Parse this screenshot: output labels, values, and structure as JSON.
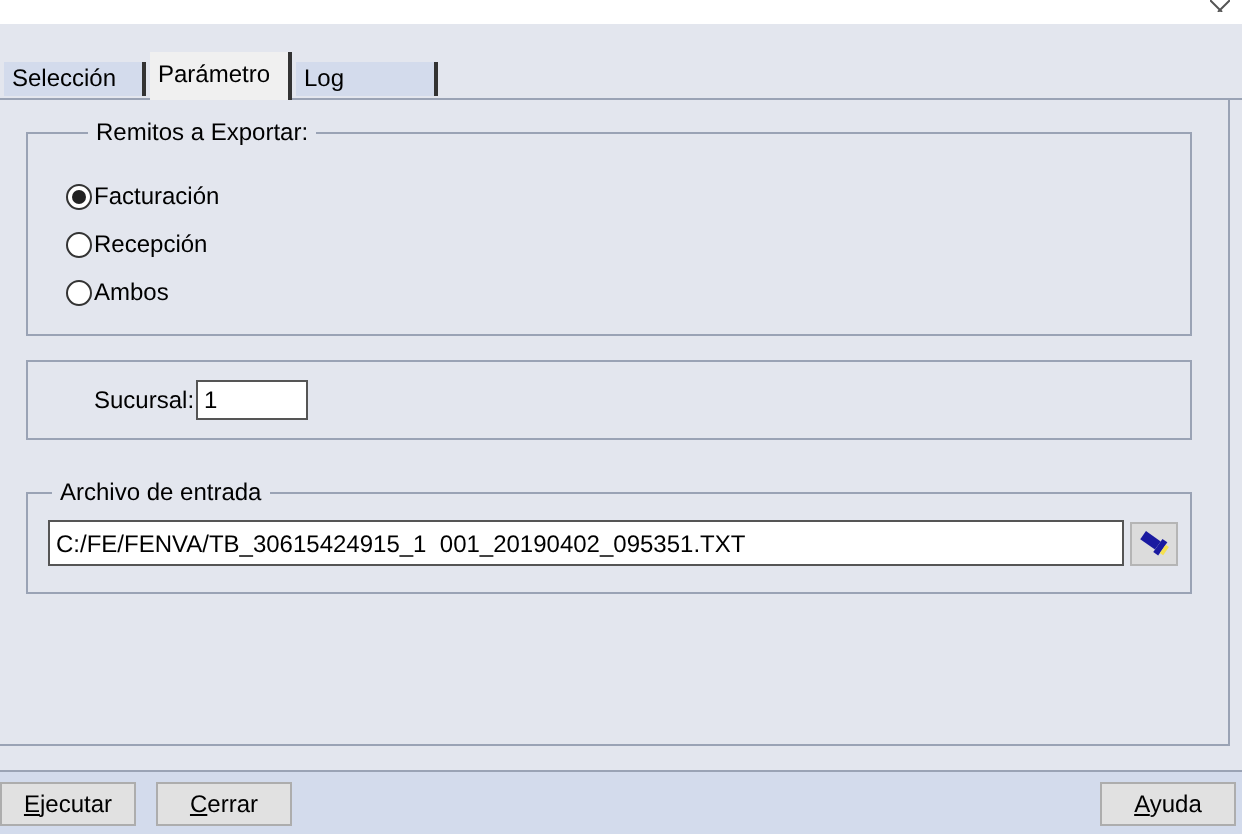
{
  "tabs": [
    {
      "label": "Selección",
      "selected": false
    },
    {
      "label": "Parámetro",
      "selected": true
    },
    {
      "label": "Log",
      "selected": false
    }
  ],
  "export_group": {
    "legend": "Remitos a Exportar:",
    "options": [
      {
        "label": "Facturación",
        "selected": true
      },
      {
        "label": "Recepción",
        "selected": false
      },
      {
        "label": "Ambos",
        "selected": false
      }
    ]
  },
  "branch": {
    "label": "Sucursal:",
    "value": "1"
  },
  "input_file": {
    "legend": "Archivo de entrada",
    "value": "C:/FE/FENVA/TB_30615424915_1  001_20190402_095351.TXT"
  },
  "left_buttons": [
    {
      "label": "Ejecutar",
      "mnemonic": true
    },
    {
      "label": "Cerrar",
      "mnemonic": true
    }
  ],
  "right_buttons": [
    {
      "label": "Ayuda",
      "mnemonic": true
    }
  ]
}
